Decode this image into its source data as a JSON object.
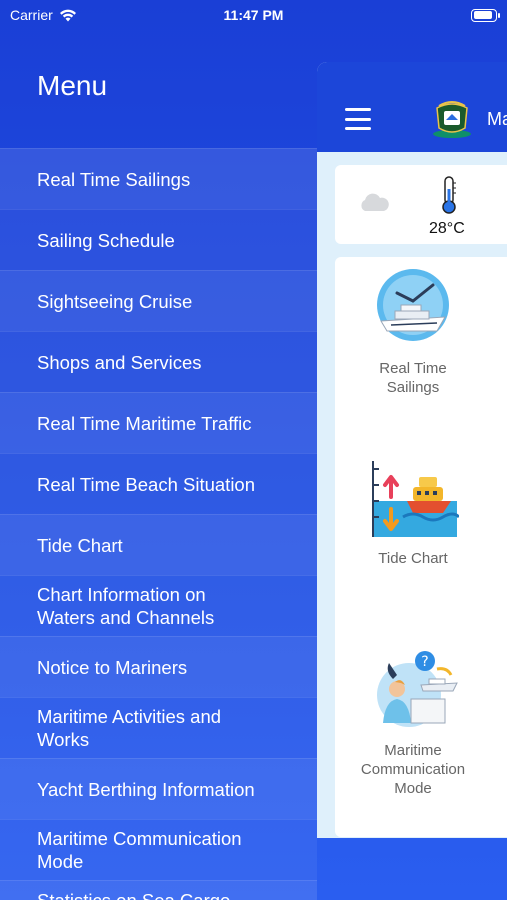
{
  "status_bar": {
    "carrier": "Carrier",
    "time": "11:47 PM"
  },
  "menu": {
    "title": "Menu",
    "items": [
      "Real Time Sailings",
      "Sailing Schedule",
      "Sightseeing Cruise",
      "Shops and Services",
      "Real Time Maritime Traffic",
      "Real Time Beach Situation",
      "Tide Chart",
      "Chart Information on Waters and Channels",
      "Notice to Mariners",
      "Maritime Activities and Works",
      "Yacht Berthing Information",
      "Maritime Communication Mode",
      "Statistics on Sea Cargo"
    ]
  },
  "main": {
    "header_title": "Ma",
    "weather": {
      "temperature": "28°C",
      "condition_icon": "cloud-icon"
    },
    "tiles": [
      {
        "label": "Real Time Sailings",
        "icon": "ship-clock-icon"
      },
      {
        "label": "Tide Chart",
        "icon": "tide-chart-icon"
      },
      {
        "label": "Maritime Communication Mode",
        "icon": "communication-icon"
      }
    ]
  }
}
